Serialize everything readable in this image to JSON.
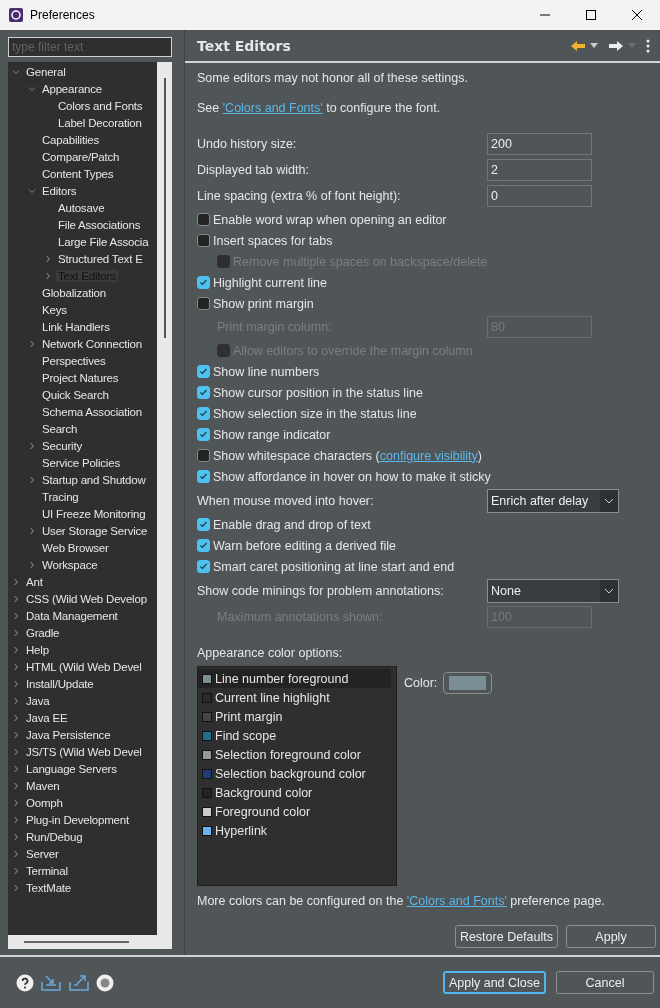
{
  "window": {
    "title": "Preferences"
  },
  "filter": {
    "placeholder": "type filter text"
  },
  "tree": [
    {
      "label": "General",
      "expanded": true,
      "selected": false,
      "children": [
        {
          "label": "Appearance",
          "expanded": true,
          "selected": false,
          "children": [
            {
              "label": "Colors and Fonts",
              "selected": false
            },
            {
              "label": "Label Decoration",
              "selected": false
            }
          ]
        },
        {
          "label": "Capabilities",
          "selected": false
        },
        {
          "label": "Compare/Patch",
          "selected": false
        },
        {
          "label": "Content Types",
          "selected": false
        },
        {
          "label": "Editors",
          "expanded": true,
          "selected": false,
          "children": [
            {
              "label": "Autosave",
              "selected": false
            },
            {
              "label": "File Associations",
              "selected": false
            },
            {
              "label": "Large File Associa",
              "selected": false
            },
            {
              "label": "Structured Text E",
              "expanded": false,
              "selected": false
            },
            {
              "label": "Text Editors",
              "expanded": false,
              "selected": true
            }
          ]
        },
        {
          "label": "Globalization",
          "selected": false
        },
        {
          "label": "Keys",
          "selected": false
        },
        {
          "label": "Link Handlers",
          "selected": false
        },
        {
          "label": "Network Connection",
          "expanded": false,
          "selected": false
        },
        {
          "label": "Perspectives",
          "selected": false
        },
        {
          "label": "Project Natures",
          "selected": false
        },
        {
          "label": "Quick Search",
          "selected": false
        },
        {
          "label": "Schema Association",
          "selected": false
        },
        {
          "label": "Search",
          "selected": false
        },
        {
          "label": "Security",
          "expanded": false,
          "selected": false
        },
        {
          "label": "Service Policies",
          "selected": false
        },
        {
          "label": "Startup and Shutdow",
          "expanded": false,
          "selected": false
        },
        {
          "label": "Tracing",
          "selected": false
        },
        {
          "label": "UI Freeze Monitoring",
          "selected": false
        },
        {
          "label": "User Storage Service",
          "expanded": false,
          "selected": false
        },
        {
          "label": "Web Browser",
          "selected": false
        },
        {
          "label": "Workspace",
          "expanded": false,
          "selected": false
        }
      ]
    },
    {
      "label": "Ant",
      "expanded": false,
      "selected": false
    },
    {
      "label": "CSS (Wild Web Develop",
      "expanded": false,
      "selected": false
    },
    {
      "label": "Data Management",
      "expanded": false,
      "selected": false
    },
    {
      "label": "Gradle",
      "expanded": false,
      "selected": false
    },
    {
      "label": "Help",
      "expanded": false,
      "selected": false
    },
    {
      "label": "HTML (Wild Web Devel",
      "expanded": false,
      "selected": false
    },
    {
      "label": "Install/Update",
      "expanded": false,
      "selected": false
    },
    {
      "label": "Java",
      "expanded": false,
      "selected": false
    },
    {
      "label": "Java EE",
      "expanded": false,
      "selected": false
    },
    {
      "label": "Java Persistence",
      "expanded": false,
      "selected": false
    },
    {
      "label": "JS/TS (Wild Web Devel",
      "expanded": false,
      "selected": false
    },
    {
      "label": "Language Servers",
      "expanded": false,
      "selected": false
    },
    {
      "label": "Maven",
      "expanded": false,
      "selected": false
    },
    {
      "label": "Oomph",
      "expanded": false,
      "selected": false
    },
    {
      "label": "Plug-in Development",
      "expanded": false,
      "selected": false
    },
    {
      "label": "Run/Debug",
      "expanded": false,
      "selected": false
    },
    {
      "label": "Server",
      "expanded": false,
      "selected": false
    },
    {
      "label": "Terminal",
      "expanded": false,
      "selected": false
    },
    {
      "label": "TextMate",
      "expanded": false,
      "selected": false
    }
  ],
  "page": {
    "title": "Text Editors",
    "intro": "Some editors may not honor all of these settings.",
    "font_note": {
      "before": "See ",
      "link": "'Colors and Fonts'",
      "after": " to configure the font."
    },
    "settings": [
      {
        "kind": "field",
        "label": "Undo history size:",
        "value": "200",
        "disabled": false
      },
      {
        "kind": "field",
        "label": "Displayed tab width:",
        "value": "2",
        "disabled": false
      },
      {
        "kind": "field",
        "label": "Line spacing (extra % of font height):",
        "value": "0",
        "disabled": false
      },
      {
        "kind": "checkbox",
        "label": "Enable word wrap when opening an editor",
        "checked": false,
        "disabled": false
      },
      {
        "kind": "checkbox",
        "label": "Insert spaces for tabs",
        "checked": false,
        "disabled": false
      },
      {
        "kind": "checkbox",
        "label": "Remove multiple spaces on backspace/delete",
        "checked": false,
        "disabled": true
      },
      {
        "kind": "checkbox",
        "label": "Highlight current line",
        "checked": true,
        "disabled": false
      },
      {
        "kind": "checkbox",
        "label": "Show print margin",
        "checked": false,
        "disabled": false
      },
      {
        "kind": "field",
        "label": "Print margin column:",
        "value": "80",
        "disabled": true
      },
      {
        "kind": "checkbox",
        "label": "Allow editors to override the margin column",
        "checked": false,
        "disabled": true
      },
      {
        "kind": "checkbox",
        "label": "Show line numbers",
        "checked": true,
        "disabled": false
      },
      {
        "kind": "checkbox",
        "label": "Show cursor position in the status line",
        "checked": true,
        "disabled": false
      },
      {
        "kind": "checkbox",
        "label": "Show selection size in the status line",
        "checked": true,
        "disabled": false
      },
      {
        "kind": "checkbox",
        "label": "Show range indicator",
        "checked": true,
        "disabled": false
      },
      {
        "kind": "checkbox",
        "label": "Show whitespace characters (",
        "link": "configure visibility",
        "suffix": ")",
        "checked": false,
        "disabled": false
      },
      {
        "kind": "checkbox",
        "label": "Show affordance in hover on how to make it sticky",
        "checked": true,
        "disabled": false
      },
      {
        "kind": "select",
        "label": "When mouse moved into hover:",
        "value": "Enrich after delay",
        "disabled": false
      },
      {
        "kind": "checkbox",
        "label": "Enable drag and drop of text",
        "checked": true,
        "disabled": false
      },
      {
        "kind": "checkbox",
        "label": "Warn before editing a derived file",
        "checked": true,
        "disabled": false
      },
      {
        "kind": "checkbox",
        "label": "Smart caret positioning at line start and end",
        "checked": true,
        "disabled": false
      },
      {
        "kind": "select",
        "label": "Show code minings for problem annotations:",
        "value": "None",
        "disabled": false
      },
      {
        "kind": "field",
        "label": "Maximum annotations shown:",
        "value": "100",
        "disabled": true
      }
    ],
    "colors": {
      "label": "Appearance color options:",
      "color_label": "Color:",
      "items": [
        {
          "label": "Line number foreground",
          "color": "#7a8e96",
          "selected": true
        },
        {
          "label": "Current line highlight",
          "color": "#2a2a2a",
          "selected": false
        },
        {
          "label": "Print margin",
          "color": "#454545",
          "selected": false
        },
        {
          "label": "Find scope",
          "color": "#1f6f8f",
          "selected": false
        },
        {
          "label": "Selection foreground color",
          "color": "#929a9a",
          "selected": false
        },
        {
          "label": "Selection background color",
          "color": "#203c7a",
          "selected": false
        },
        {
          "label": "Background color",
          "color": "#232323",
          "selected": false
        },
        {
          "label": "Foreground color",
          "color": "#cccccc",
          "selected": false
        },
        {
          "label": "Hyperlink",
          "color": "#6ab0f3",
          "selected": false
        }
      ]
    },
    "more_note": {
      "before": "More colors can be configured on the ",
      "link": "'Colors and Fonts'",
      "after": " preference page."
    },
    "buttons": [
      "Restore Defaults",
      "Apply"
    ]
  },
  "footer_buttons": [
    {
      "label": "Apply and Close",
      "default": true
    },
    {
      "label": "Cancel",
      "default": false
    }
  ]
}
